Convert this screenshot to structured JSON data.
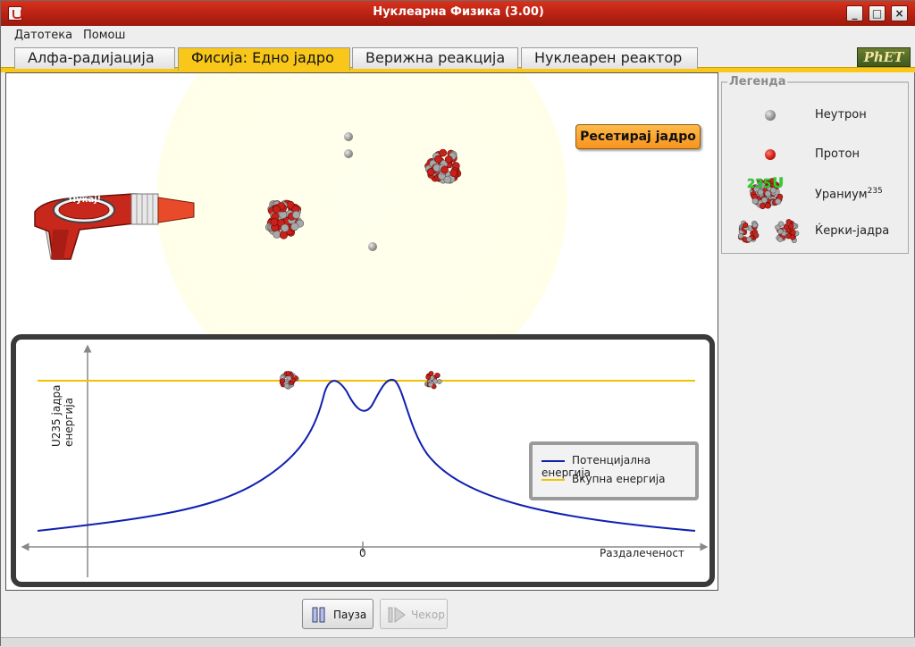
{
  "window": {
    "title": "Нуклеарна Физика (3.00)",
    "controls": {
      "minimize": "_",
      "maximize": "□",
      "close": "×"
    }
  },
  "menu": {
    "items": [
      "Датотека",
      "Помош"
    ]
  },
  "tabs": [
    {
      "label": "Алфа-радијација",
      "active": false
    },
    {
      "label": "Фисија: Едно јадро",
      "active": true
    },
    {
      "label": "Верижна реакција",
      "active": false
    },
    {
      "label": "Нуклеарен реактор",
      "active": false
    }
  ],
  "logo": {
    "text": "PhET"
  },
  "play_area": {
    "reset_button": "Ресетирај јадро",
    "gun_label": "Пукај!"
  },
  "graph": {
    "ylabel_line1": "U235 јадра",
    "ylabel_line2": "енергија",
    "zero_label": "0",
    "xlabel": "Раздалеченост",
    "legend": {
      "potential": "Потенцијална енергија",
      "total": "Вкупна енергија"
    },
    "colors": {
      "potential": "#1020b0",
      "total": "#f2c200"
    }
  },
  "controls": {
    "pause": "Пауза",
    "step": "Чекор"
  },
  "legend": {
    "title": "Легенда",
    "neutron": "Неутрон",
    "proton": "Протон",
    "uranium": "Ураниум",
    "uranium_sup": "235",
    "uranium_badge": "235",
    "uranium_badge_letter": "U",
    "daughter": "Ќерки-јадра"
  }
}
